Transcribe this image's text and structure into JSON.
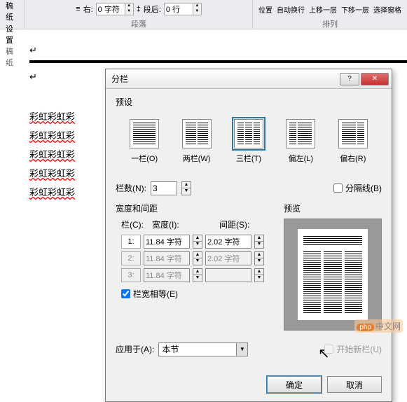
{
  "ribbon": {
    "group1": {
      "line1": "稿纸",
      "line2": "设置",
      "label": "稿纸"
    },
    "indent": {
      "right_label": "右:",
      "right_value": "0 字符",
      "after_label": "段后:",
      "after_value": "0 行",
      "group_label": "段落"
    },
    "arrange": {
      "items": [
        "位置",
        "自动换行",
        "上移一层",
        "下移一层",
        "选择窗格"
      ],
      "group_label": "排列"
    }
  },
  "document": {
    "para_mark": "↵",
    "red_lines": [
      "彩虹彩虹彩",
      "彩虹彩虹彩",
      "彩虹彩虹彩",
      "彩虹彩虹彩",
      "彩虹彩虹彩"
    ]
  },
  "dialog": {
    "title": "分栏",
    "help": "?",
    "close": "✕",
    "presets_label": "预设",
    "presets": [
      {
        "label": "一栏(O)",
        "cols": [
          1
        ]
      },
      {
        "label": "两栏(W)",
        "cols": [
          1,
          1
        ]
      },
      {
        "label": "三栏(T)",
        "cols": [
          1,
          1,
          1
        ],
        "selected": true
      },
      {
        "label": "偏左(L)",
        "cols": [
          0.5,
          1
        ]
      },
      {
        "label": "偏右(R)",
        "cols": [
          1,
          0.5
        ]
      }
    ],
    "col_count_label": "栏数(N):",
    "col_count_value": "3",
    "divider_checkbox": "分隔线(B)",
    "width_section": "宽度和间距",
    "preview_label": "预览",
    "width_headers": {
      "col": "栏(C):",
      "width": "宽度(I):",
      "spacing": "间距(S):"
    },
    "width_rows": [
      {
        "idx": "1:",
        "width": "11.84 字符",
        "spacing": "2.02 字符",
        "enabled": true
      },
      {
        "idx": "2:",
        "width": "11.84 字符",
        "spacing": "2.02 字符",
        "enabled": false
      },
      {
        "idx": "3:",
        "width": "11.84 字符",
        "spacing": "",
        "enabled": false
      }
    ],
    "equal_width": "栏宽相等(E)",
    "equal_width_checked": true,
    "apply_to_label": "应用于(A):",
    "apply_to_value": "本节",
    "start_new_col": "开始新栏(U)",
    "ok": "确定",
    "cancel": "取消"
  },
  "watermark": "中文网"
}
